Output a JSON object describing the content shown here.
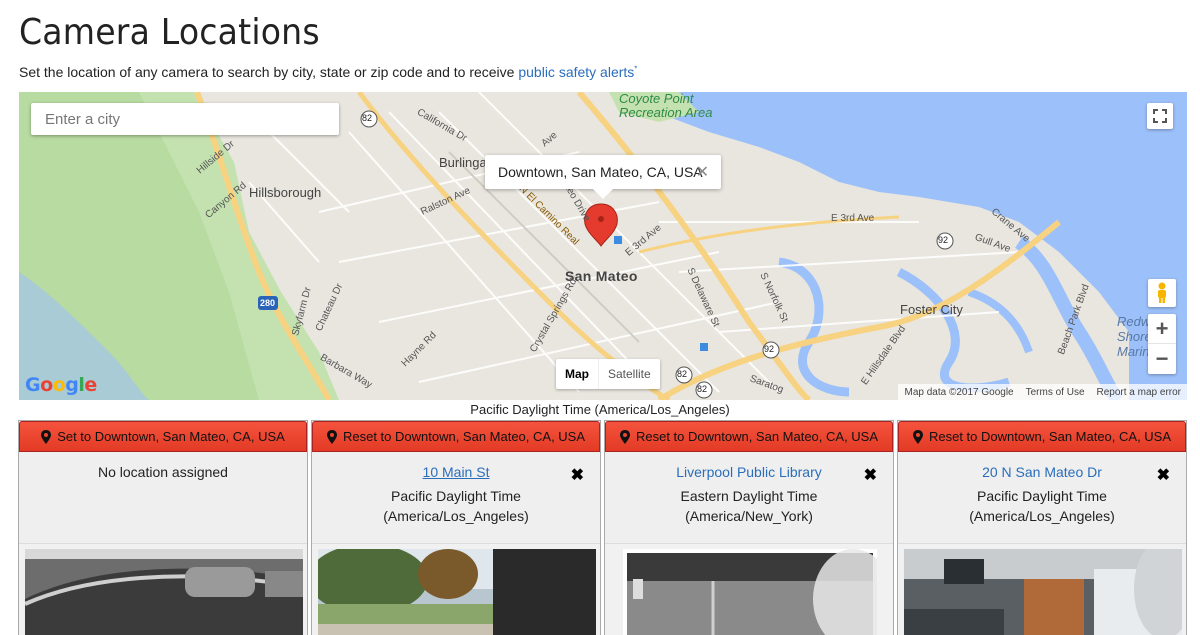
{
  "page": {
    "title": "Camera Locations",
    "subtitle_prefix": "Set the location of any camera to search by city, state or zip code and to receive ",
    "subtitle_link": "public safety alerts",
    "subtitle_sup": "*"
  },
  "map": {
    "search_placeholder": "Enter a city",
    "info_window_text": "Downtown, San Mateo, CA, USA",
    "info_close": "✕",
    "maptype_map": "Map",
    "maptype_satellite": "Satellite",
    "google_logo": [
      "G",
      "o",
      "o",
      "g",
      "l",
      "e"
    ],
    "logo_colors": [
      "#4285f4",
      "#ea4335",
      "#fbbc05",
      "#4285f4",
      "#34a853",
      "#ea4335"
    ],
    "attribution": [
      "Map data ©2017 Google",
      "Terms of Use",
      "Report a map error"
    ],
    "labels": {
      "city_main": "San Mateo",
      "hillsborough": "Hillsborough",
      "burlingame": "Burlinga",
      "foster_city": "Foster City",
      "coyote_point_1": "Coyote Point",
      "coyote_point_2": "Recreation Area",
      "redwood_1": "Redw",
      "redwood_2": "Shores",
      "redwood_3": "Marine",
      "california_dr": "California Dr",
      "hillside_dr": "Hillside Dr",
      "canyon_rd": "Canyon Rd",
      "ralston_ave": "Ralston Ave",
      "el_camino": "N El Camino Real",
      "san_mateo_dr": "Mateo Drive",
      "e_3rd_ave": "E 3rd Ave",
      "e_3rd_ave_2": "E 3rd Ave",
      "crane_ave": "Crane Ave",
      "gull_ave": "Gull Ave",
      "delaware": "S Delaware St",
      "norfolk": "S Norfolk St",
      "crystal_springs": "Crystal Springs Rd",
      "skyfarm": "Skyfarm Dr",
      "chateau": "Chateau Dr",
      "barbara_way": "Barbara Way",
      "hayne_rd": "Hayne Rd",
      "beach_park": "Beach Park Blvd",
      "hillsdale": "E Hillsdale Blvd",
      "saratoga": "Saratog",
      "ave": "Ave",
      "r82a": "82",
      "r82b": "82",
      "r82c": "82",
      "r92a": "92",
      "r92b": "92",
      "r92c": "92",
      "r280": "280"
    },
    "colors": {
      "land": "#e9e6df",
      "green": "#c4e2b0",
      "water": "#9cc0f9",
      "highway": "#f7d281",
      "road": "#ffffff",
      "marker": "#e53b2e"
    }
  },
  "timezone_line": "Pacific Daylight Time (America/Los_Angeles)",
  "cards": [
    {
      "button": "Set to Downtown, San Mateo, CA, USA",
      "location": "",
      "no_location": "No location assigned",
      "tz_line1": "",
      "tz_line2": "",
      "removable": false
    },
    {
      "button": "Reset to Downtown, San Mateo, CA, USA",
      "location": "10 Main St",
      "no_location": "",
      "tz_line1": "Pacific Daylight Time",
      "tz_line2": "(America/Los_Angeles)",
      "removable": true
    },
    {
      "button": "Reset to Downtown, San Mateo, CA, USA",
      "location": "Liverpool Public Library",
      "no_location": "",
      "tz_line1": "Eastern Daylight Time",
      "tz_line2": "(America/New_York)",
      "removable": true
    },
    {
      "button": "Reset to Downtown, San Mateo, CA, USA",
      "location": "20 N San Mateo Dr",
      "no_location": "",
      "tz_line1": "Pacific Daylight Time",
      "tz_line2": "(America/Los_Angeles)",
      "removable": true
    }
  ],
  "icons": {
    "pin": "map-marker-icon",
    "remove": "✖"
  }
}
